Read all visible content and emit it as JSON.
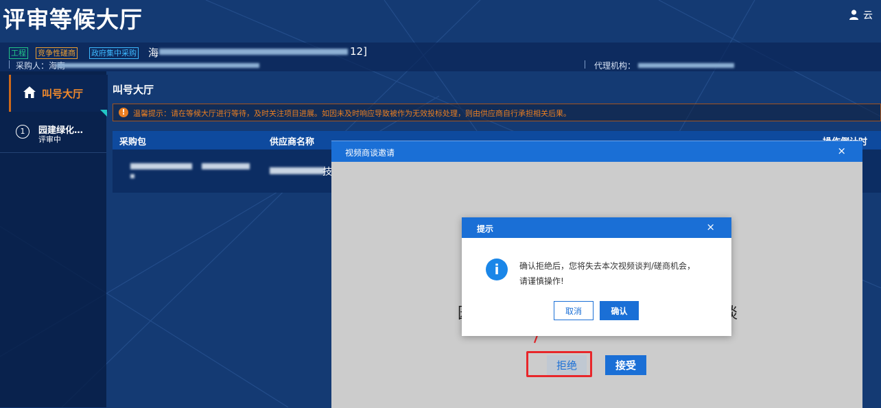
{
  "app": {
    "title": "评审等候大厅",
    "user_name": "云"
  },
  "project": {
    "tags": [
      "工程",
      "竞争性磋商",
      "政府集中采购"
    ],
    "name_prefix": "海",
    "name_suffix": "12]",
    "purchaser_label": "采购人：海南",
    "agency_label": "代理机构："
  },
  "sidebar": {
    "active_item": "叫号大厅",
    "project_item": {
      "number": "1",
      "name": "园建绿化…",
      "status": "评审中"
    }
  },
  "main": {
    "title": "叫号大厅",
    "notice_icon": "!",
    "notice": "温馨提示：请在等候大厅进行等待，及时关注项目进展。如因未及时响应导致被作为无效投标处理，则由供应商自行承担相关后果。",
    "table": {
      "headers": [
        "采购包",
        "供应商名称",
        "操作倒计时"
      ],
      "row_fragment": "技"
    }
  },
  "video_modal": {
    "title": "视频商谈邀请",
    "close": "×",
    "text_left": "园",
    "text_right": "谈",
    "reject_label": "拒绝",
    "accept_label": "接受"
  },
  "dialog": {
    "title": "提示",
    "close": "×",
    "icon": "i",
    "message_line1": "确认拒绝后，您将失去本次视频谈判/磋商机会，",
    "message_line2": "请谨慎操作!",
    "cancel_label": "取消",
    "confirm_label": "确认"
  },
  "colors": {
    "primary_blue": "#1a6fd6",
    "warning_orange": "#e87e22",
    "highlight_red": "#e8262a",
    "page_bg": "#143a73"
  }
}
